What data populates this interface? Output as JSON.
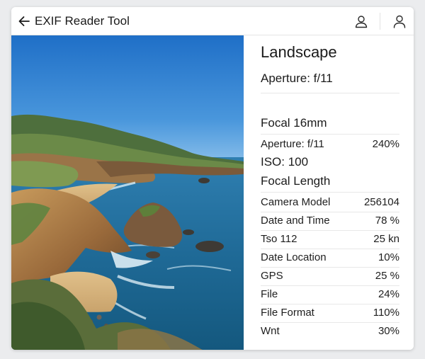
{
  "app": {
    "title": "EXIF Reader Tool",
    "back_icon": "arrow-left-icon",
    "user_icons": [
      "user-icon",
      "user-profile-icon"
    ]
  },
  "photo": {
    "subject": "coastal landscape",
    "colors": {
      "sky": "#3a86d4",
      "ocean": "#1f6a97",
      "cliff": "#b78a52",
      "grass": "#6f8a45"
    }
  },
  "panel": {
    "title": "Landscape",
    "aperture_heading": "Aperture: f/11",
    "focal_heading": "Focal 16mm",
    "aperture_row": {
      "label": "Aperture: f/11",
      "value": "240%"
    },
    "iso_heading": "ISO: 100",
    "focal_length_heading": "Focal Length",
    "rows": [
      {
        "label": "Camera Model",
        "value": "256104"
      },
      {
        "label": "Date and Time",
        "value": "78 %"
      },
      {
        "label": "Tso 112",
        "value": "25 kn"
      },
      {
        "label": "Date Location",
        "value": "10%"
      },
      {
        "label": "GPS",
        "value": "25 %"
      },
      {
        "label": "File",
        "value": "24%"
      },
      {
        "label": "File Format",
        "value": "110%"
      },
      {
        "label": "Wnt",
        "value": "30%"
      }
    ]
  }
}
